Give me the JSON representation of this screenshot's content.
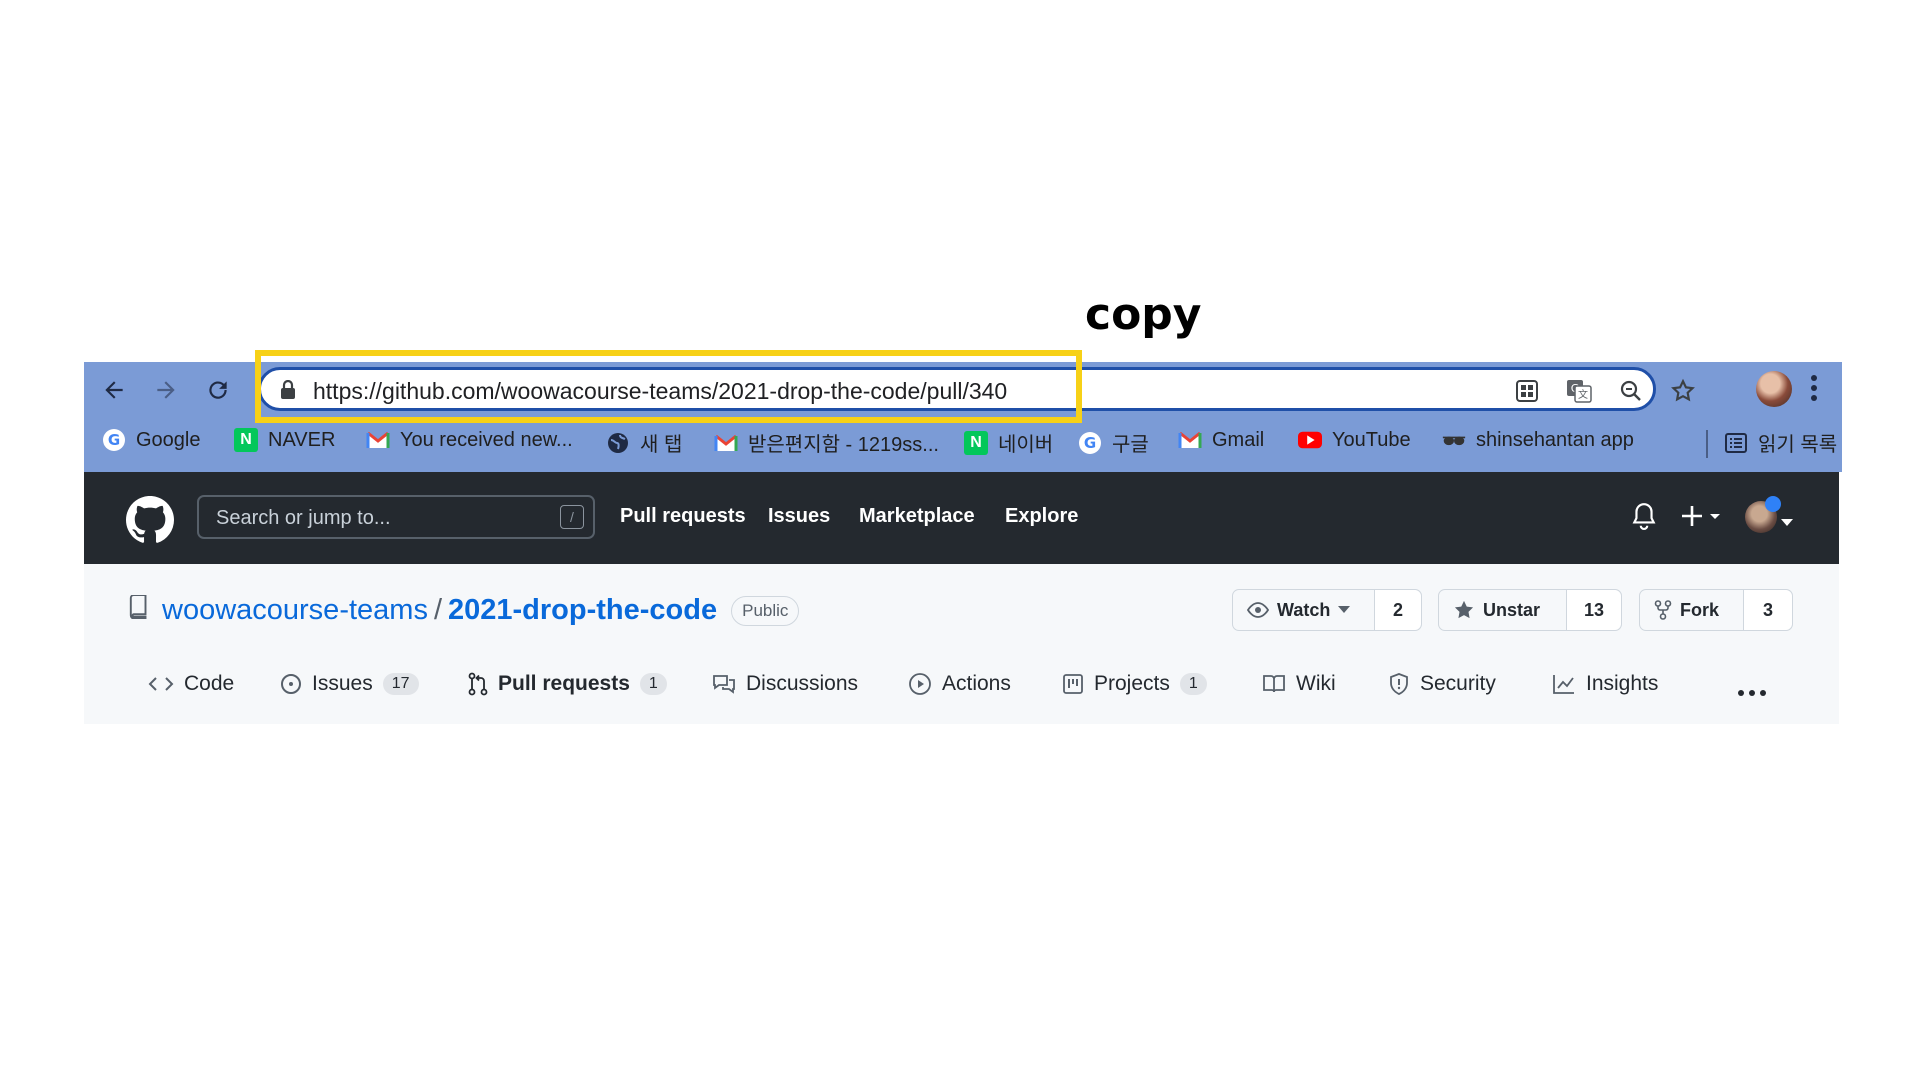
{
  "annotation": {
    "label": "copy",
    "color": "#f7d117"
  },
  "browser": {
    "url": "https://github.com/woowacourse-teams/2021-drop-the-code/pull/340",
    "bookmarks": [
      {
        "label": "Google",
        "icon": "google-icon"
      },
      {
        "label": "NAVER",
        "icon": "naver-icon"
      },
      {
        "label": "You received new...",
        "icon": "gmail-icon"
      },
      {
        "label": "새 탭",
        "icon": "globe-icon"
      },
      {
        "label": "받은편지함 - 1219ss...",
        "icon": "gmail-icon"
      },
      {
        "label": "네이버",
        "icon": "naver-icon"
      },
      {
        "label": "구글",
        "icon": "google-icon"
      },
      {
        "label": "Gmail",
        "icon": "gmail-icon"
      },
      {
        "label": "YouTube",
        "icon": "youtube-icon"
      },
      {
        "label": "shinsehantan app",
        "icon": "sunglasses-icon"
      }
    ],
    "reading_list": "읽기 목록"
  },
  "github": {
    "search_placeholder": "Search or jump to...",
    "search_shortcut": "/",
    "nav": [
      "Pull requests",
      "Issues",
      "Marketplace",
      "Explore"
    ],
    "repo": {
      "owner": "woowacourse-teams",
      "separator": "/",
      "name": "2021-drop-the-code",
      "visibility": "Public"
    },
    "actions": {
      "watch_label": "Watch",
      "watch_count": "2",
      "star_label": "Unstar",
      "star_count": "13",
      "fork_label": "Fork",
      "fork_count": "3"
    },
    "tabs": [
      {
        "label": "Code"
      },
      {
        "label": "Issues",
        "count": "17"
      },
      {
        "label": "Pull requests",
        "count": "1"
      },
      {
        "label": "Discussions"
      },
      {
        "label": "Actions"
      },
      {
        "label": "Projects",
        "count": "1"
      },
      {
        "label": "Wiki"
      },
      {
        "label": "Security"
      },
      {
        "label": "Insights"
      }
    ],
    "active_tab": "Pull requests"
  }
}
